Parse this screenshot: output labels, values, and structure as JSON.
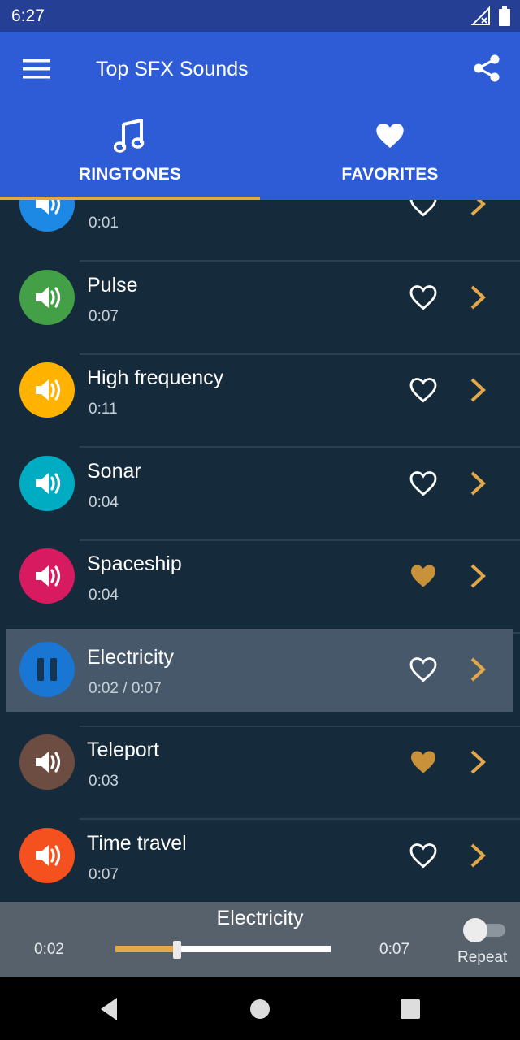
{
  "status_bar": {
    "time": "6:27",
    "icons": [
      "signal-icon",
      "battery-icon"
    ]
  },
  "app_bar": {
    "title": "Top SFX Sounds",
    "menu_icon": "menu-icon",
    "share_icon": "share-icon"
  },
  "tabs": [
    {
      "label": "RINGTONES",
      "icon": "music-note-icon",
      "selected": true
    },
    {
      "label": "FAVORITES",
      "icon": "heart-icon",
      "selected": false
    }
  ],
  "colors": {
    "app_bar": "#2e5cd6",
    "status_bar": "#243f93",
    "list_background": "#152a3a",
    "accent": "#e2a84a",
    "favorite_filled": "#c9923a"
  },
  "sounds": [
    {
      "title": "",
      "duration": "0:01",
      "color": "#1e88e5",
      "favorite": false,
      "playing": false
    },
    {
      "title": "Pulse",
      "duration": "0:07",
      "color": "#43a047",
      "favorite": false,
      "playing": false
    },
    {
      "title": "High frequency",
      "duration": "0:11",
      "color": "#ffb300",
      "favorite": false,
      "playing": false
    },
    {
      "title": "Sonar",
      "duration": "0:04",
      "color": "#00acc1",
      "favorite": false,
      "playing": false
    },
    {
      "title": "Spaceship",
      "duration": "0:04",
      "color": "#d81b60",
      "favorite": true,
      "playing": false
    },
    {
      "title": "Electricity",
      "duration": "0:02 /  0:07",
      "color": "#1976d2",
      "favorite": false,
      "playing": true
    },
    {
      "title": "Teleport",
      "duration": "0:03",
      "color": "#6d4c41",
      "favorite": true,
      "playing": false
    },
    {
      "title": "Time travel",
      "duration": "0:07",
      "color": "#f4511e",
      "favorite": false,
      "playing": false
    }
  ],
  "player": {
    "title": "Electricity",
    "current": "0:02",
    "total": "0:07",
    "progress": 0.285,
    "repeat_label": "Repeat",
    "repeat_on": false
  },
  "nav_bar": {
    "buttons": [
      "back-icon",
      "home-icon",
      "recent-apps-icon"
    ]
  }
}
